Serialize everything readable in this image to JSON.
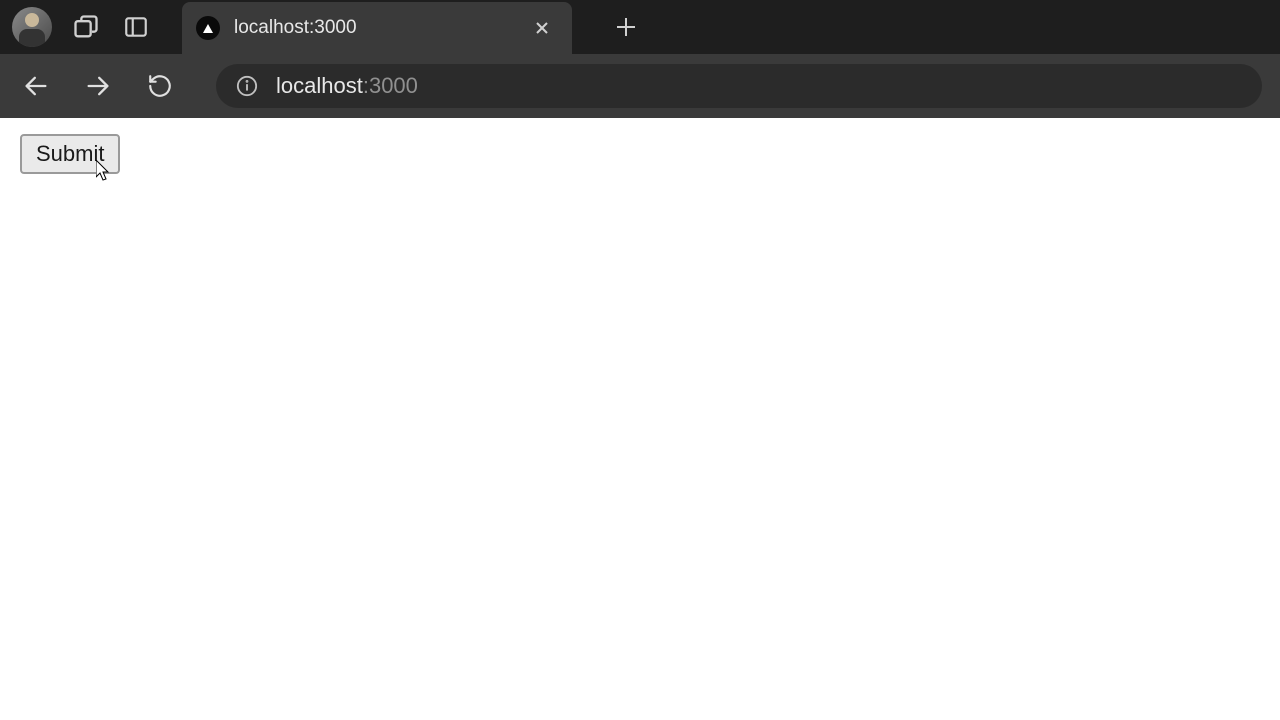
{
  "tab": {
    "title": "localhost:3000"
  },
  "url": {
    "host": "localhost",
    "port": ":3000"
  },
  "page": {
    "submit_label": "Submit"
  }
}
